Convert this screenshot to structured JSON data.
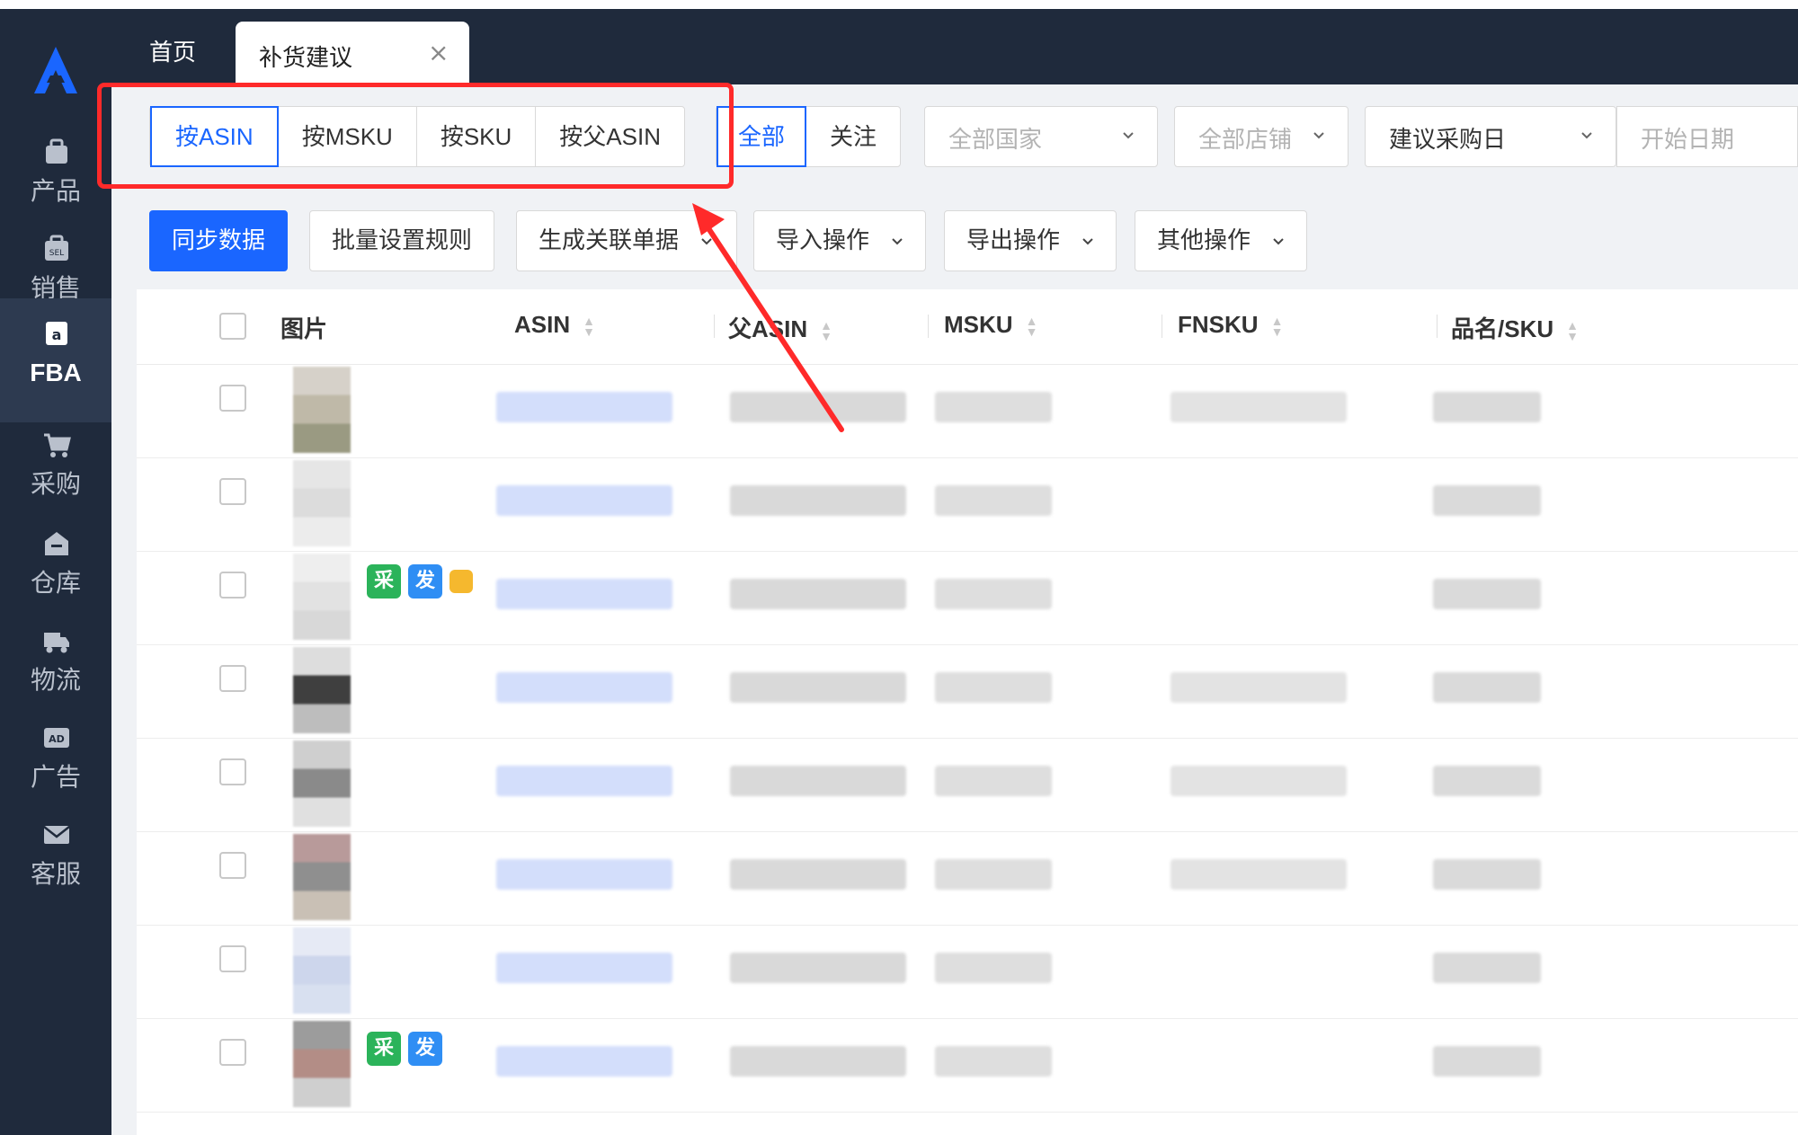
{
  "sidebar": {
    "items": [
      {
        "label": "产品",
        "icon": "product-icon"
      },
      {
        "label": "销售",
        "icon": "sales-icon"
      },
      {
        "label": "FBA",
        "icon": "fba-icon",
        "active": true
      },
      {
        "label": "采购",
        "icon": "cart-icon"
      },
      {
        "label": "仓库",
        "icon": "warehouse-icon"
      },
      {
        "label": "物流",
        "icon": "truck-icon"
      },
      {
        "label": "广告",
        "icon": "ad-icon"
      },
      {
        "label": "客服",
        "icon": "mail-icon"
      }
    ]
  },
  "tabs": {
    "home": "首页",
    "active": "补货建议",
    "close": "×"
  },
  "filters": {
    "group_by": [
      "按ASIN",
      "按MSKU",
      "按SKU",
      "按父ASIN"
    ],
    "scope": [
      "全部",
      "关注"
    ],
    "country_placeholder": "全部国家",
    "shop_placeholder": "全部店铺",
    "date_type": "建议采购日",
    "start_date_placeholder": "开始日期"
  },
  "actions": {
    "sync": "同步数据",
    "batch_rules": "批量设置规则",
    "gen_orders": "生成关联单据",
    "import": "导入操作",
    "export": "导出操作",
    "other": "其他操作"
  },
  "table": {
    "columns": [
      "图片",
      "ASIN",
      "父ASIN",
      "MSKU",
      "FNSKU",
      "品名/SKU"
    ],
    "rows": [
      {
        "tags": []
      },
      {
        "tags": []
      },
      {
        "tags": [
          "采",
          "发"
        ],
        "flag": true
      },
      {
        "tags": []
      },
      {
        "tags": []
      },
      {
        "tags": []
      },
      {
        "tags": []
      },
      {
        "tags": [
          "采",
          "发"
        ]
      }
    ]
  },
  "colors": {
    "sidebar_bg": "#1f2a3c",
    "accent": "#1a66ff",
    "highlight": "#ff2a2a",
    "tag_purchase": "#2bb35a",
    "tag_ship": "#2f8ef4"
  }
}
